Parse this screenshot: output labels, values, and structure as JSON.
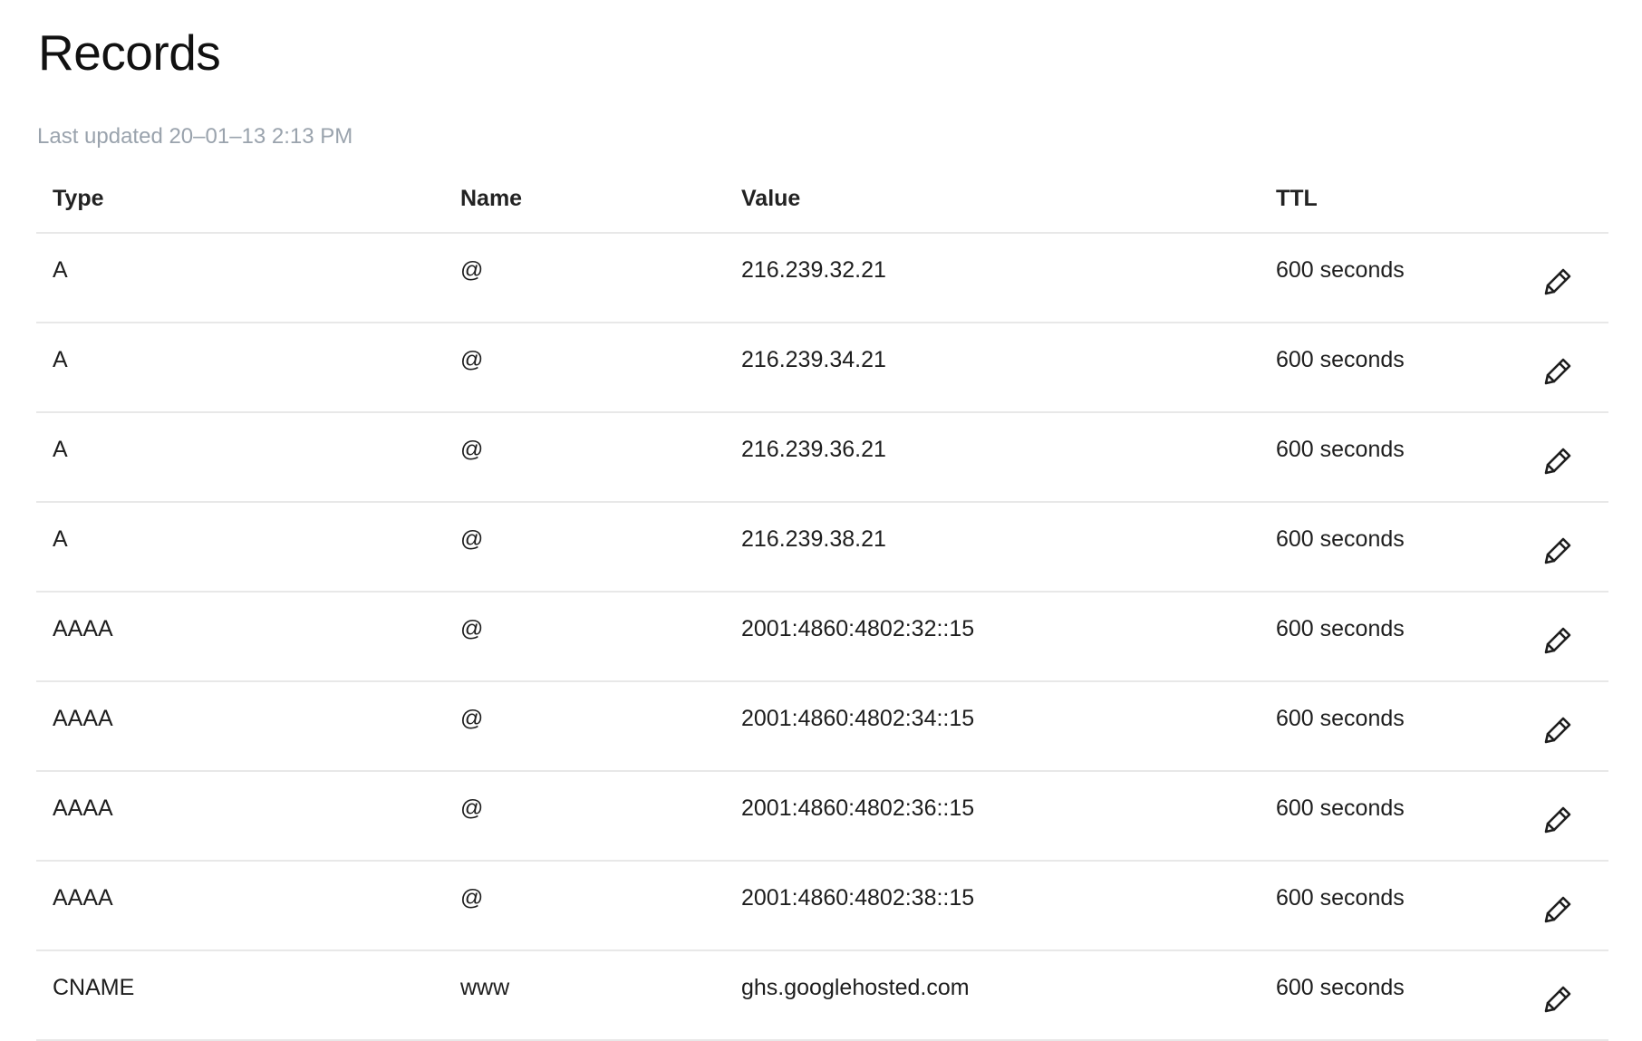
{
  "header": {
    "title": "Records",
    "last_updated": "Last updated 20–01–13 2:13 PM"
  },
  "table": {
    "columns": [
      "Type",
      "Name",
      "Value",
      "TTL"
    ],
    "rows": [
      {
        "type": "A",
        "name": "@",
        "value": "216.239.32.21",
        "ttl": "600 seconds"
      },
      {
        "type": "A",
        "name": "@",
        "value": "216.239.34.21",
        "ttl": "600 seconds"
      },
      {
        "type": "A",
        "name": "@",
        "value": "216.239.36.21",
        "ttl": "600 seconds"
      },
      {
        "type": "A",
        "name": "@",
        "value": "216.239.38.21",
        "ttl": "600 seconds"
      },
      {
        "type": "AAAA",
        "name": "@",
        "value": "2001:4860:4802:32::15",
        "ttl": "600 seconds"
      },
      {
        "type": "AAAA",
        "name": "@",
        "value": "2001:4860:4802:34::15",
        "ttl": "600 seconds"
      },
      {
        "type": "AAAA",
        "name": "@",
        "value": "2001:4860:4802:36::15",
        "ttl": "600 seconds"
      },
      {
        "type": "AAAA",
        "name": "@",
        "value": "2001:4860:4802:38::15",
        "ttl": "600 seconds"
      },
      {
        "type": "CNAME",
        "name": "www",
        "value": "ghs.googlehosted.com",
        "ttl": "600 seconds"
      }
    ],
    "row_action_icon": "pencil-icon"
  },
  "colors": {
    "text": "#1e1e1e",
    "muted": "#9aa3ad",
    "divider": "#e8e8e8",
    "background": "#ffffff"
  }
}
